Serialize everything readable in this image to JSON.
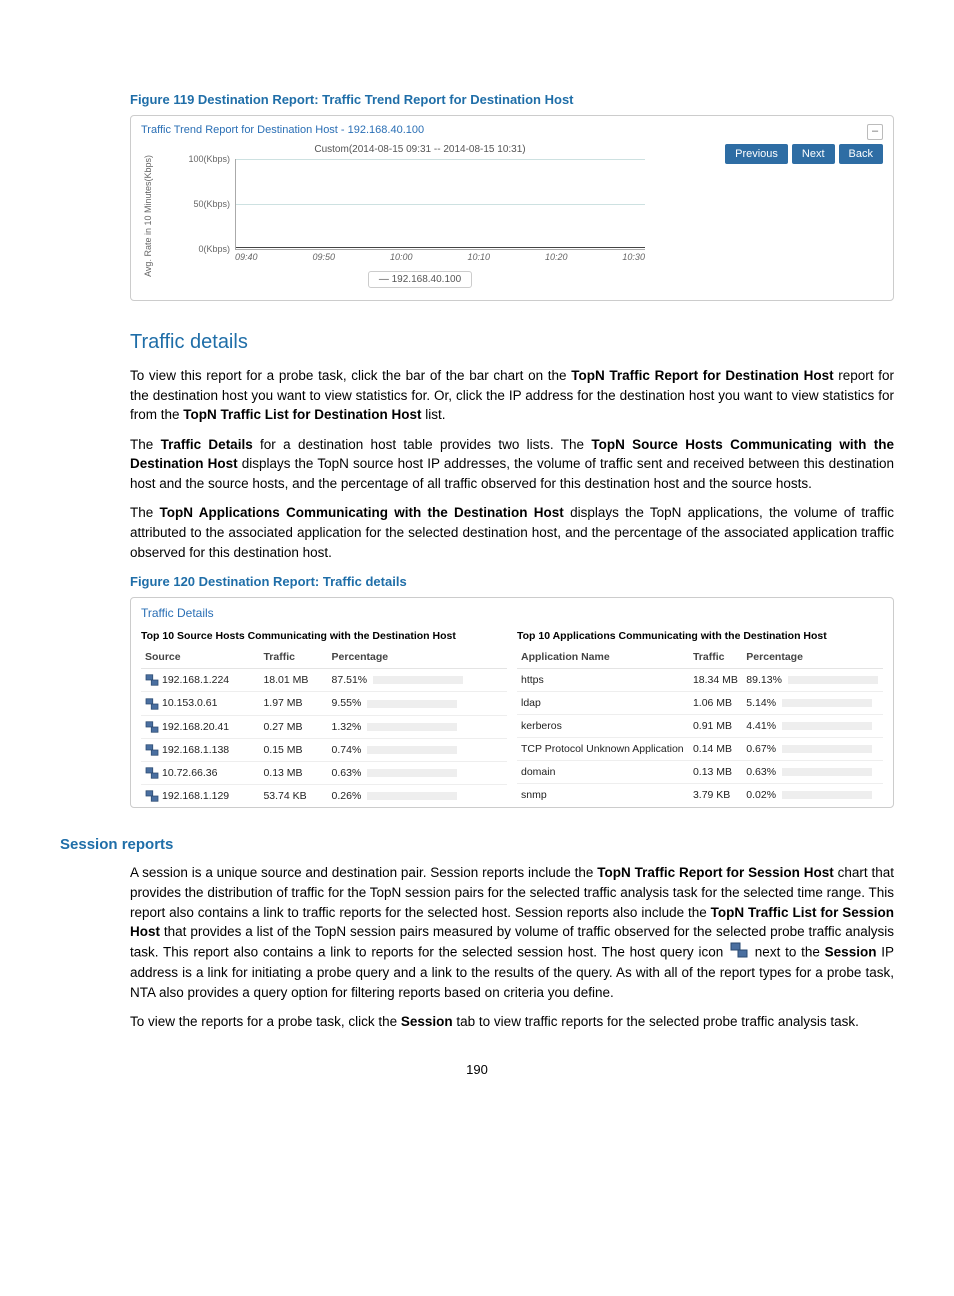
{
  "figure119": {
    "caption": "Figure 119 Destination Report: Traffic Trend Report for Destination Host",
    "panel_title": "Traffic Trend Report for Destination Host - 192.168.40.100",
    "nav": {
      "previous": "Previous",
      "next": "Next",
      "back": "Back"
    },
    "collapse": "–",
    "legend_text": "— 192.168.40.100"
  },
  "chart_data": {
    "type": "line",
    "title": "Custom(2014-08-15 09:31 -- 2014-08-15 10:31)",
    "ylabel": "Avg. Rate in 10 Minutes(Kbps)",
    "y_ticks": [
      "100(Kbps)",
      "50(Kbps)",
      "0(Kbps)"
    ],
    "x": [
      "09:40",
      "09:50",
      "10:00",
      "10:10",
      "10:20",
      "10:30"
    ],
    "series": [
      {
        "name": "192.168.40.100",
        "values": [
          0,
          0,
          0,
          0,
          0,
          0
        ]
      }
    ],
    "ylim": [
      0,
      100
    ]
  },
  "traffic_details_section": {
    "title": "Traffic details",
    "p1_pre": "To view this report for a probe task, click the bar of the bar chart on the ",
    "p1_b1": "TopN Traffic Report for Destination Host",
    "p1_mid1": " report for the destination host you want to view statistics for. Or, click the IP address for the destination host you want to view statistics for from the ",
    "p1_b2": "TopN Traffic List for Destination Host",
    "p1_post": " list.",
    "p2_pre": "The ",
    "p2_b1": "Traffic Details",
    "p2_mid1": " for a destination host table provides two lists. The ",
    "p2_b2": "TopN Source Hosts Communicating with the Destination Host",
    "p2_post": " displays the TopN source host IP addresses, the volume of traffic sent and received between this destination host and the source hosts, and the percentage of all traffic observed for this destination host and the source hosts.",
    "p3_pre": "The ",
    "p3_b1": "TopN Applications Communicating with the Destination Host",
    "p3_post": " displays the TopN applications, the volume of traffic attributed to the associated application for the selected destination host, and the percentage of the associated application traffic observed for this destination host."
  },
  "figure120": {
    "caption": "Figure 120 Destination Report: Traffic details",
    "panel_title": "Traffic Details",
    "left_table_title": "Top 10 Source Hosts Communicating with the Destination Host",
    "right_table_title": "Top 10 Applications Communicating with the Destination Host",
    "cols_src": {
      "source": "Source",
      "traffic": "Traffic",
      "percentage": "Percentage"
    },
    "cols_app": {
      "app": "Application Name",
      "traffic": "Traffic",
      "percentage": "Percentage"
    },
    "src_rows": [
      {
        "source": "192.168.1.224",
        "traffic": "18.01 MB",
        "pct": "87.51%",
        "w": 87.51
      },
      {
        "source": "10.153.0.61",
        "traffic": "1.97 MB",
        "pct": "9.55%",
        "w": 9.55
      },
      {
        "source": "192.168.20.41",
        "traffic": "0.27 MB",
        "pct": "1.32%",
        "w": 1.32
      },
      {
        "source": "192.168.1.138",
        "traffic": "0.15 MB",
        "pct": "0.74%",
        "w": 0.74
      },
      {
        "source": "10.72.66.36",
        "traffic": "0.13 MB",
        "pct": "0.63%",
        "w": 0.63
      },
      {
        "source": "192.168.1.129",
        "traffic": "53.74 KB",
        "pct": "0.26%",
        "w": 0.26
      }
    ],
    "app_rows": [
      {
        "app": "https",
        "traffic": "18.34 MB",
        "pct": "89.13%",
        "w": 89.13
      },
      {
        "app": "ldap",
        "traffic": "1.06 MB",
        "pct": "5.14%",
        "w": 5.14
      },
      {
        "app": "kerberos",
        "traffic": "0.91 MB",
        "pct": "4.41%",
        "w": 4.41
      },
      {
        "app": "TCP Protocol Unknown Application",
        "traffic": "0.14 MB",
        "pct": "0.67%",
        "w": 0.67
      },
      {
        "app": "domain",
        "traffic": "0.13 MB",
        "pct": "0.63%",
        "w": 0.63
      },
      {
        "app": "snmp",
        "traffic": "3.79 KB",
        "pct": "0.02%",
        "w": 0.02
      }
    ]
  },
  "session_reports": {
    "title": "Session reports",
    "p1_pre": "A session is a unique source and destination pair. Session reports include the ",
    "p1_b1": "TopN Traffic Report for Session Host",
    "p1_mid1": " chart that provides the distribution of traffic for the TopN session pairs for the selected traffic analysis task for the selected time range. This report also contains a link to traffic reports for the selected host. Session reports also include the ",
    "p1_b2": "TopN Traffic List for Session Host",
    "p1_post": " that provides a list of the TopN session pairs measured by volume of traffic observed for the selected probe traffic analysis task. This report also contains a link to reports for the selected session host. The host query icon ",
    "p1_after_icon": " next to the ",
    "p1_b3": "Session",
    "p1_tail": " IP address is a link for initiating a probe query and a link to the results of the query. As with all of the report types for a probe task, NTA also provides a query option for filtering reports based on criteria you define.",
    "p2_pre": "To view the reports for a probe task, click the ",
    "p2_b1": "Session",
    "p2_post": " tab to view traffic reports for the selected probe traffic analysis task."
  },
  "page_number": "190",
  "icons": {
    "host_query": "host-query-icon"
  }
}
